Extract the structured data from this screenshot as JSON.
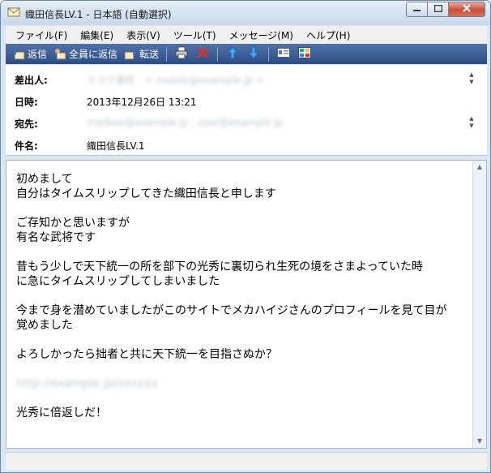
{
  "window": {
    "title": "織田信長LV.1 - 日本語 (自動選択)"
  },
  "menu": [
    {
      "label": "ファイル(F)"
    },
    {
      "label": "編集(E)"
    },
    {
      "label": "表示(V)"
    },
    {
      "label": "ツール(T)"
    },
    {
      "label": "メッセージ(M)"
    },
    {
      "label": "ヘルプ(H)"
    }
  ],
  "toolbar": {
    "reply": "返信",
    "reply_all": "全員に返信",
    "forward": "転送"
  },
  "header": {
    "from_label": "差出人:",
    "from_value": " ミラク属性　< mobile@example.jp >",
    "date_label": "日時:",
    "date_value": "2013年12月26日 13:21",
    "to_label": "宛先:",
    "to_value": "mailbox@example.jp ; user@example.jp",
    "subject_label": "件名:",
    "subject_value": "織田信長LV.1"
  },
  "message": {
    "lines": [
      "初めまして",
      "自分はタイムスリップしてきた織田信長と申します",
      "",
      "ご存知かと思いますが",
      "有名な武将です",
      "",
      "昔もう少しで天下統一の所を部下の光秀に裏切られ生死の境をさまよっていた時",
      "に急にタイムスリップしてしまいました",
      "",
      "今まで身を潜めていましたがこのサイトでメカハイジさんのプロフィールを見て目が",
      "覚めました",
      "",
      "よろしかったら拙者と共に天下統一を目指さぬか？",
      "",
      "http://example.jp/xxxxxx",
      "",
      "光秀に倍返しだ！"
    ]
  }
}
